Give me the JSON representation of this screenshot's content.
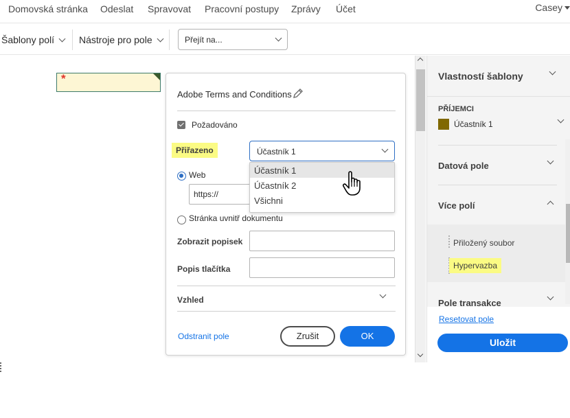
{
  "nav": {
    "items": [
      "Domovská stránka",
      "Odeslat",
      "Spravovat",
      "Pracovní postupy",
      "Zprávy",
      "Účet"
    ],
    "user": "Casey"
  },
  "toolbar": {
    "field_templates": "Šablony polí",
    "field_tools": "Nástroje pro pole",
    "goto_placeholder": "Přejít na..."
  },
  "popup": {
    "title": "Adobe Terms and Conditions",
    "required_label": "Požadováno",
    "assigned_label": "Přiřazeno",
    "assigned_value": "Účastník 1",
    "web_label": "Web",
    "url_value": "https://",
    "page_in_doc_label": "Stránka uvnitř dokumentu",
    "display_label_label": "Zobrazit popisek",
    "button_label_label": "Popis tlačítka",
    "appearance_label": "Vzhled",
    "delete_link": "Odstranit pole",
    "cancel_button": "Zrušit",
    "ok_button": "OK"
  },
  "dropdown": {
    "options": [
      "Účastník 1",
      "Účastník 2",
      "Všichni"
    ]
  },
  "right_panel": {
    "header": "Vlastností šablony",
    "recipients_label": "PŘÍJEMCI",
    "recipient": "Účastník 1",
    "recipient_color": "#806800",
    "data_fields": "Datová pole",
    "more_fields": "Více polí",
    "attachment": "Přiložený soubor",
    "hyperlink": "Hypervazba",
    "transaction_fields": "Pole transakce",
    "reset_link": "Resetovat pole",
    "save_button": "Uložit"
  },
  "field_marker": "*",
  "colors": {
    "accent": "#1473e6",
    "highlight": "#fbfb84"
  }
}
